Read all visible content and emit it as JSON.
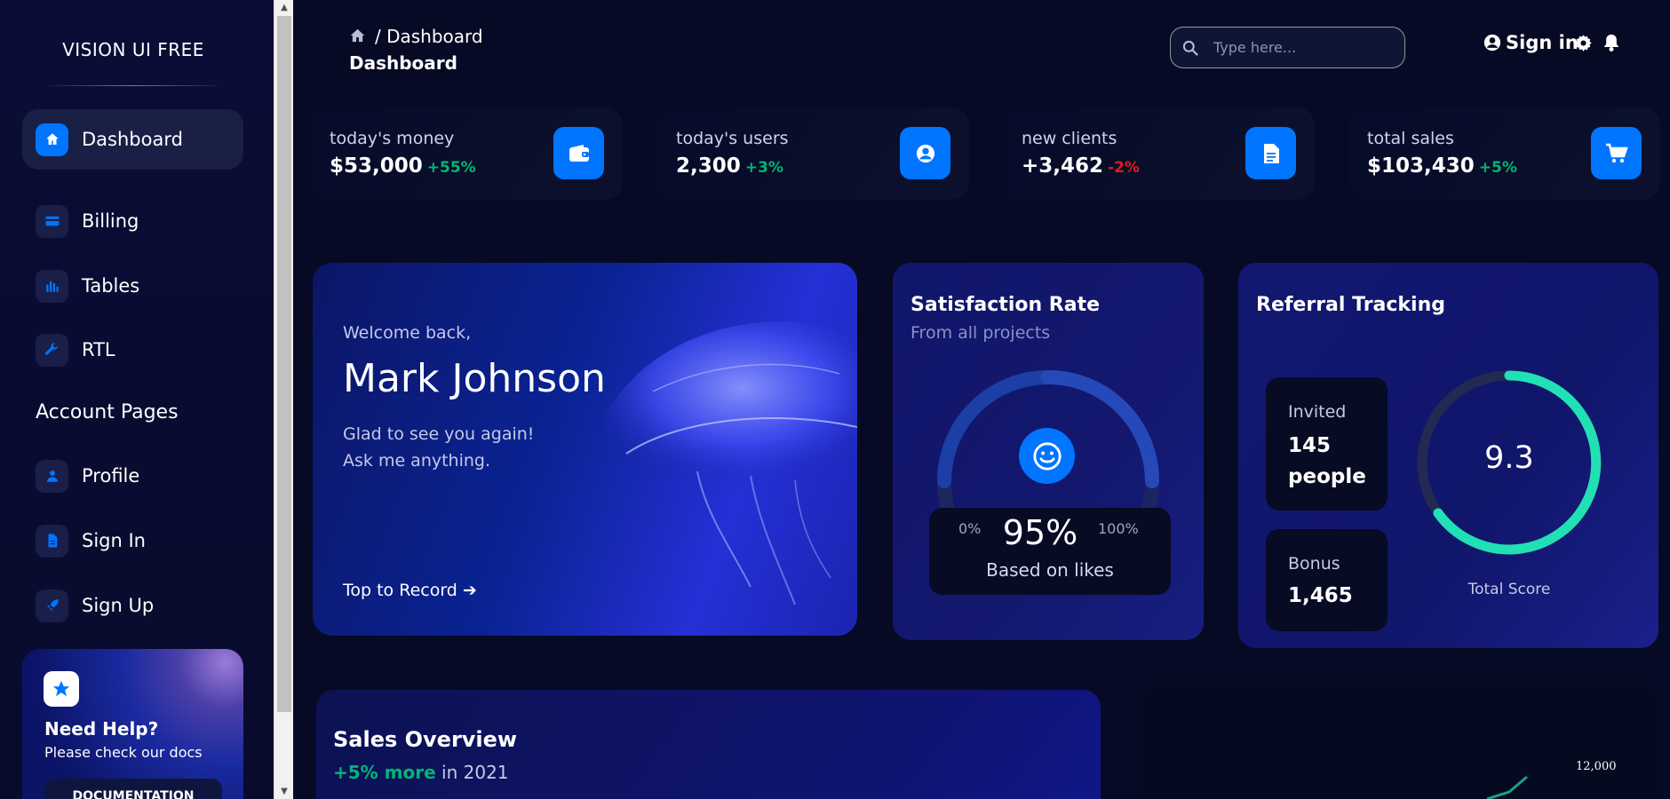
{
  "brand": "VISION UI FREE",
  "sidebar": {
    "items": [
      {
        "label": "Dashboard"
      },
      {
        "label": "Billing"
      },
      {
        "label": "Tables"
      },
      {
        "label": "RTL"
      }
    ],
    "section": "Account Pages",
    "account_items": [
      {
        "label": "Profile"
      },
      {
        "label": "Sign In"
      },
      {
        "label": "Sign Up"
      }
    ],
    "help": {
      "title": "Need Help?",
      "subtitle": "Please check our docs",
      "button": "DOCUMENTATION"
    }
  },
  "header": {
    "crumb": "/ Dashboard",
    "title": "Dashboard",
    "search_placeholder": "Type here...",
    "signin": "Sign in"
  },
  "stats": [
    {
      "label": "today's money",
      "value": "$53,000",
      "change": "+55%",
      "change_color": "#01b574"
    },
    {
      "label": "today's users",
      "value": "2,300",
      "change": "+3%",
      "change_color": "#01b574"
    },
    {
      "label": "new clients",
      "value": "+3,462",
      "change": "-2%",
      "change_color": "#e31a1a"
    },
    {
      "label": "total sales",
      "value": "$103,430",
      "change": "+5%",
      "change_color": "#01b574"
    }
  ],
  "welcome": {
    "pre": "Welcome back,",
    "name": "Mark Johnson",
    "line1": "Glad to see you again!",
    "line2": "Ask me anything.",
    "link": "Top to Record"
  },
  "satisfaction": {
    "title": "Satisfaction Rate",
    "subtitle": "From all projects",
    "min": "0%",
    "max": "100%",
    "value": "95%",
    "caption": "Based on likes"
  },
  "referral": {
    "title": "Referral Tracking",
    "invited_label": "Invited",
    "invited_value_1": "145",
    "invited_value_2": "people",
    "bonus_label": "Bonus",
    "bonus_value": "1,465",
    "score": "9.3",
    "score_label": "Total Score"
  },
  "sales": {
    "title": "Sales Overview",
    "change": "+5% more",
    "period": "in 2021"
  },
  "chart2": {
    "tick": "12,000"
  },
  "colors": {
    "accent": "#0075ff",
    "positive": "#01b574",
    "negative": "#e31a1a",
    "score_ring": "#21e1b4"
  }
}
